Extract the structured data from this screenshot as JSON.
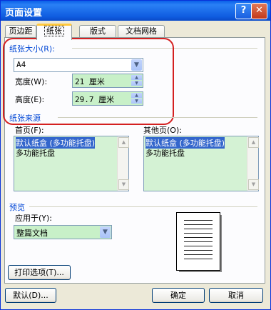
{
  "window": {
    "title": "页面设置"
  },
  "titlebar": {
    "help_label": "?",
    "close_label": "✕"
  },
  "tabs": [
    {
      "label": "页边距"
    },
    {
      "label": "纸张"
    },
    {
      "label": "版式"
    },
    {
      "label": "文档网格"
    }
  ],
  "paper_size": {
    "group_label": "纸张大小(R):",
    "selected": "A4",
    "width_label": "宽度(W):",
    "width_value": "21 厘米",
    "height_label": "高度(E):",
    "height_value": "29.7 厘米"
  },
  "paper_source": {
    "group_label": "纸张来源",
    "first_page_label": "首页(F):",
    "first_page_items": [
      "默认纸盒 (多功能托盘)",
      "多功能托盘"
    ],
    "other_pages_label": "其他页(O):",
    "other_pages_items": [
      "默认纸盒 (多功能托盘)",
      "多功能托盘"
    ]
  },
  "preview": {
    "group_label": "预览",
    "apply_to_label": "应用于(Y):",
    "apply_to_value": "整篇文档"
  },
  "buttons": {
    "print_options": "打印选项(T)...",
    "default": "默认(D)...",
    "ok": "确定",
    "cancel": "取消"
  },
  "colors": {
    "title_bar": "#0a5fe8",
    "accent": "#0046d5",
    "annotation_ring": "#d42020",
    "field_bg": "#c8f0c8"
  }
}
